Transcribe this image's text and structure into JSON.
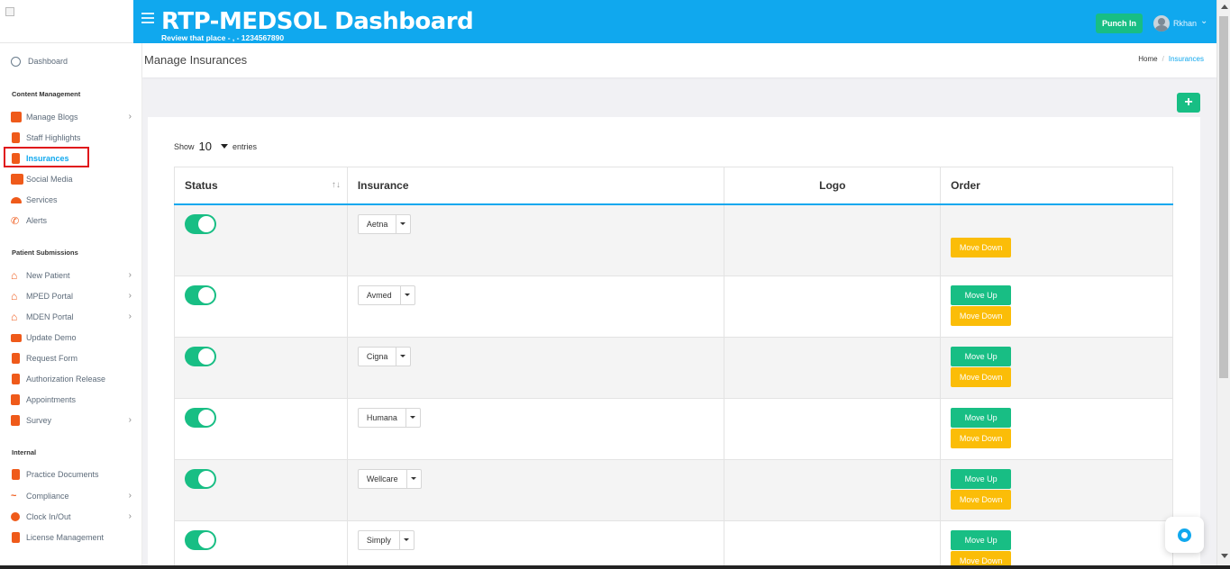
{
  "header": {
    "title": "RTP-MEDSOL Dashboard",
    "subtitle": "Review that place - , - 1234567890",
    "punch_label": "Punch In",
    "user_name": "Rkhan",
    "user_caret": "⌄",
    "accent_color": "#10a8ee"
  },
  "sidebar": {
    "dashboard": "Dashboard",
    "sections": {
      "content": "Content Management",
      "patient": "Patient Submissions",
      "internal": "Internal"
    },
    "items": [
      {
        "label": "Manage Blogs",
        "icon": "rss-icon",
        "chevron": "›"
      },
      {
        "label": "Staff Highlights",
        "icon": "badge-icon"
      },
      {
        "label": "Insurances",
        "icon": "hospital-icon",
        "active": true
      },
      {
        "label": "Social Media",
        "icon": "share-icon"
      },
      {
        "label": "Services",
        "icon": "cloud-icon"
      },
      {
        "label": "Alerts",
        "icon": "phone-icon"
      },
      {
        "label": "New Patient",
        "icon": "home-icon",
        "chevron": "›"
      },
      {
        "label": "MPED Portal",
        "icon": "home-icon",
        "chevron": "›"
      },
      {
        "label": "MDEN Portal",
        "icon": "home-icon",
        "chevron": "›"
      },
      {
        "label": "Update Demo",
        "icon": "id-card-icon"
      },
      {
        "label": "Request Form",
        "icon": "file-icon"
      },
      {
        "label": "Authorization Release",
        "icon": "clipboard-check-icon"
      },
      {
        "label": "Appointments",
        "icon": "calendar-icon"
      },
      {
        "label": "Survey",
        "icon": "chart-icon",
        "chevron": "›"
      },
      {
        "label": "Practice Documents",
        "icon": "clipboard-icon"
      },
      {
        "label": "Compliance",
        "icon": "signature-icon",
        "chevron": "›"
      },
      {
        "label": "Clock In/Out",
        "icon": "clock-icon",
        "chevron": "›"
      },
      {
        "label": "License Management",
        "icon": "clipboard-icon"
      }
    ]
  },
  "page": {
    "title": "Manage Insurances",
    "breadcrumb_home": "Home",
    "breadcrumb_sep": "/",
    "breadcrumb_current": "Insurances",
    "add_label": "+"
  },
  "table": {
    "show_label": "Show",
    "entries_value": "10",
    "entries_label": "entries",
    "sort_glyph": "↑↓",
    "columns": [
      "Status",
      "Insurance",
      "Logo",
      "Order"
    ],
    "move_up_label": "Move Up",
    "move_down_label": "Move Down",
    "rows": [
      {
        "name": "Aetna",
        "enabled": true
      },
      {
        "name": "Avmed",
        "enabled": true
      },
      {
        "name": "Cigna",
        "enabled": true
      },
      {
        "name": "Humana",
        "enabled": true
      },
      {
        "name": "Wellcare",
        "enabled": true
      },
      {
        "name": "Simply",
        "enabled": true
      }
    ]
  }
}
